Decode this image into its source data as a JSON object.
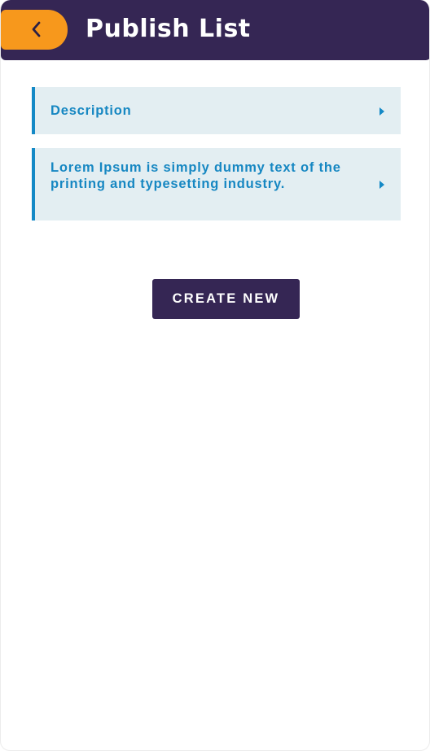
{
  "header": {
    "title": "Publish List",
    "back_icon": "chevron-left-icon",
    "colors": {
      "bar": "#352654",
      "back_button": "#f7981c"
    }
  },
  "list": {
    "items": [
      {
        "label": "Description",
        "icon": "caret-right-icon"
      },
      {
        "label": "Lorem Ipsum is simply dummy text of the printing and typesetting industry.",
        "icon": "caret-right-icon"
      }
    ],
    "colors": {
      "background": "#e3eef2",
      "accent": "#1489c6",
      "text": "#1687c2"
    }
  },
  "actions": {
    "create_label": "CREATE NEW"
  }
}
